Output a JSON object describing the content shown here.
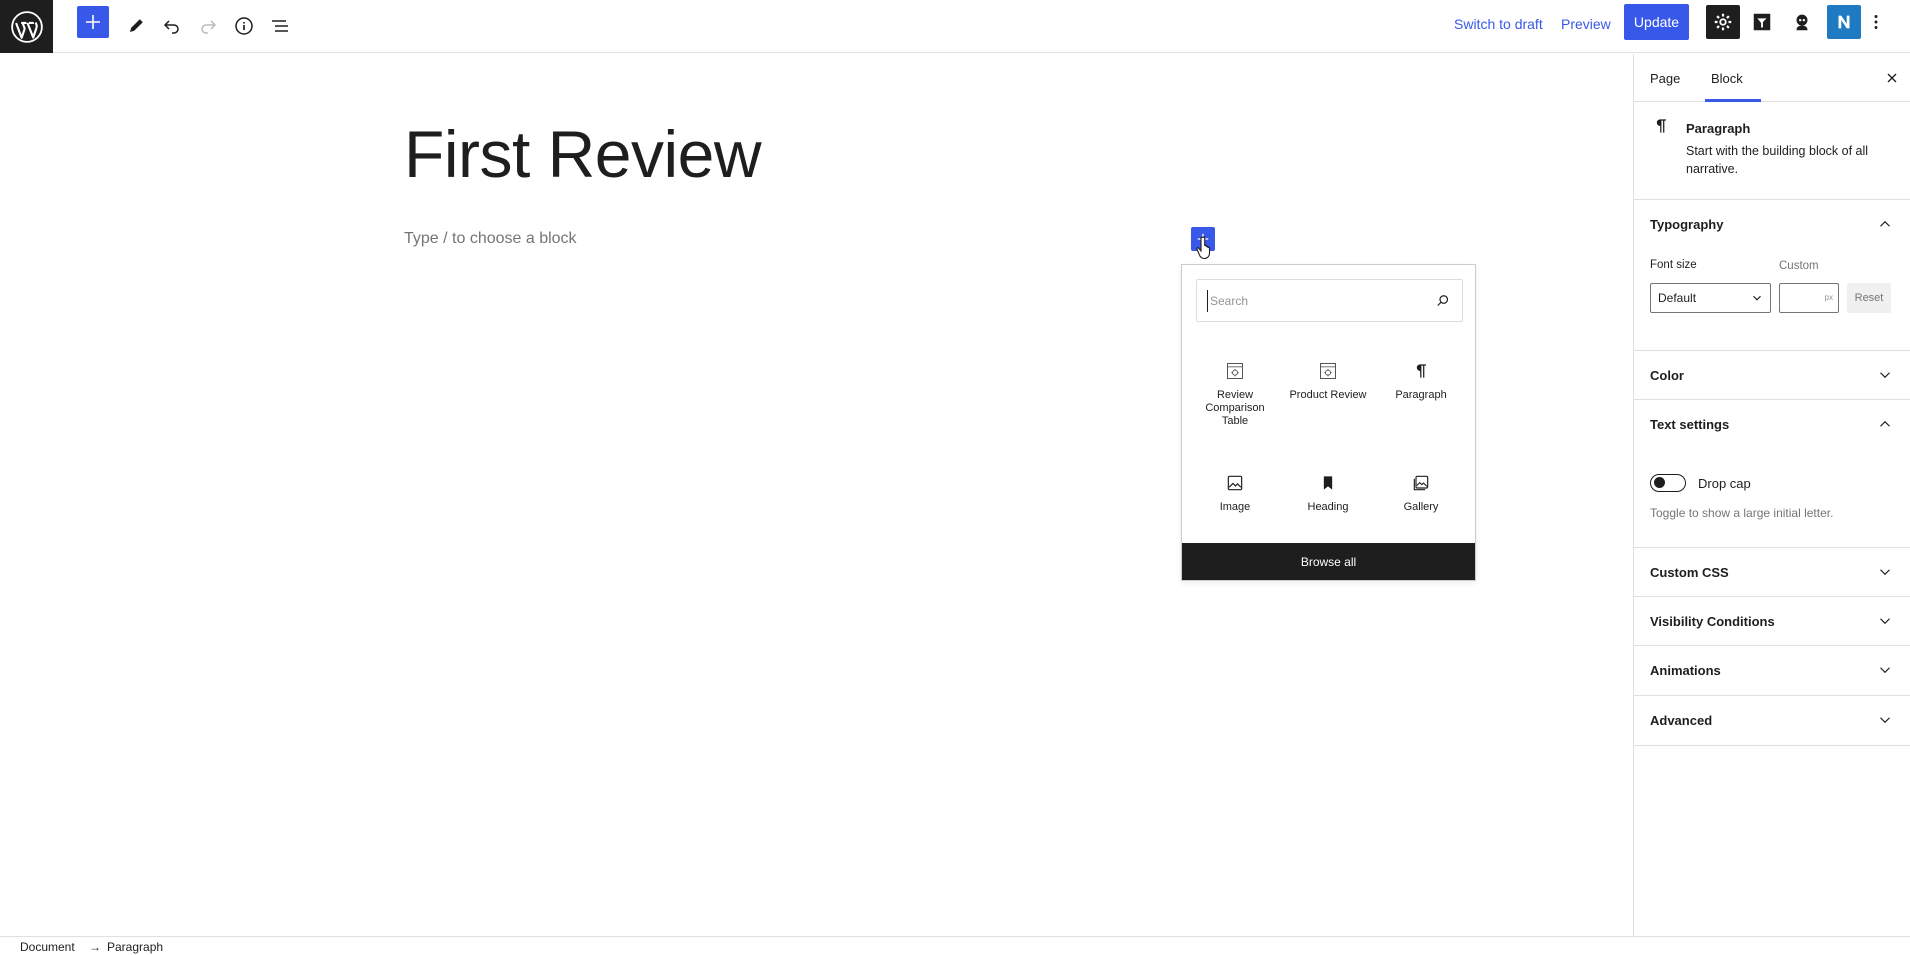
{
  "topbar": {
    "switch_to_draft": "Switch to draft",
    "preview": "Preview",
    "update": "Update",
    "colors": {
      "accent": "#3858e9",
      "dark": "#1e1e1e",
      "plugin_blue": "#1e7ac1"
    }
  },
  "editor": {
    "title": "First Review",
    "placeholder": "Type / to choose a block"
  },
  "inserter": {
    "search_placeholder": "Search",
    "blocks": [
      {
        "label": "Review Comparison Table",
        "icon": "block-default-icon"
      },
      {
        "label": "Product Review",
        "icon": "block-default-icon"
      },
      {
        "label": "Paragraph",
        "icon": "pilcrow-icon"
      },
      {
        "label": "Image",
        "icon": "image-icon"
      },
      {
        "label": "Heading",
        "icon": "bookmark-icon"
      },
      {
        "label": "Gallery",
        "icon": "gallery-icon"
      }
    ],
    "browse_all": "Browse all"
  },
  "sidebar": {
    "tabs": {
      "page": "Page",
      "block": "Block"
    },
    "block_card": {
      "title": "Paragraph",
      "description": "Start with the building block of all narrative."
    },
    "typography": {
      "title": "Typography",
      "font_size_label": "Font size",
      "custom_label": "Custom",
      "font_size_value": "Default",
      "unit": "px",
      "reset": "Reset"
    },
    "color": {
      "title": "Color"
    },
    "text_settings": {
      "title": "Text settings",
      "drop_cap_label": "Drop cap",
      "drop_cap_help": "Toggle to show a large initial letter."
    },
    "custom_css": {
      "title": "Custom CSS"
    },
    "visibility": {
      "title": "Visibility Conditions"
    },
    "animations": {
      "title": "Animations"
    },
    "advanced": {
      "title": "Advanced"
    }
  },
  "footer": {
    "crumbs": [
      "Document",
      "Paragraph"
    ],
    "separator": "→"
  }
}
